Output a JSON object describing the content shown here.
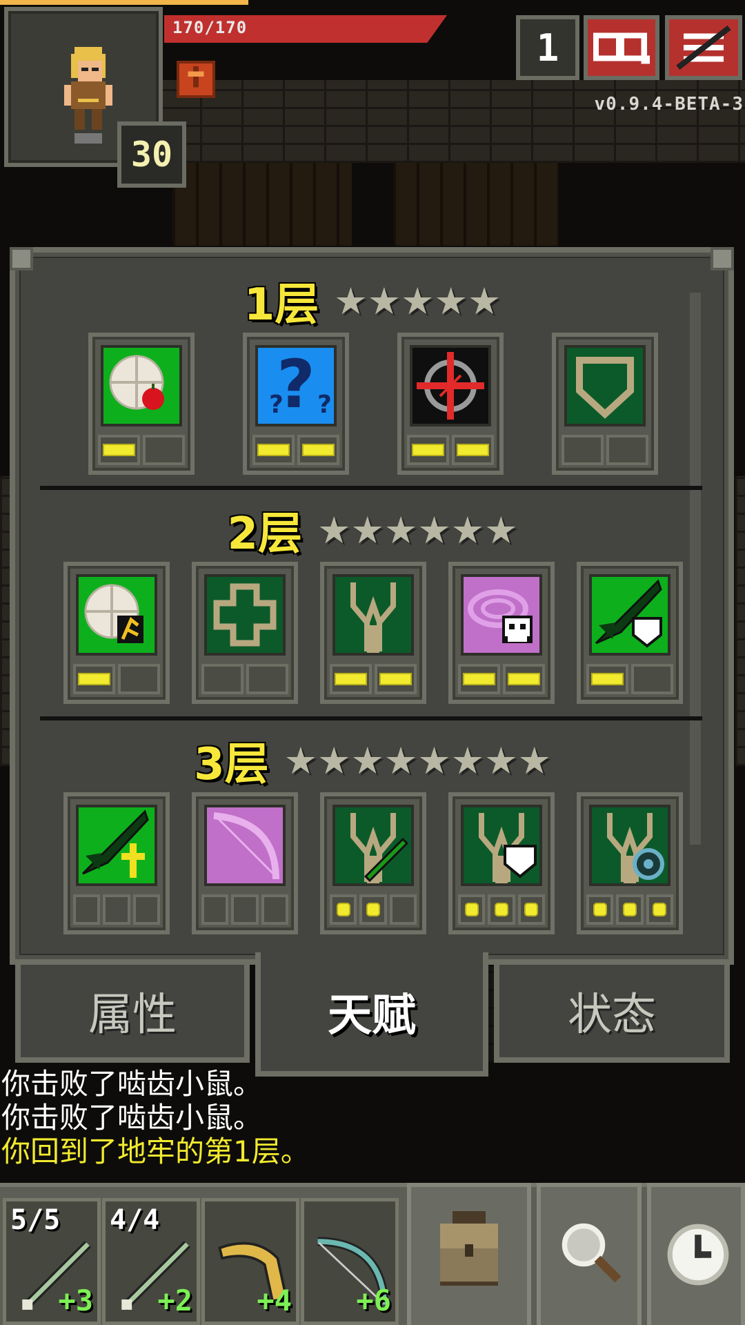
{
  "hud": {
    "hp": "170/170",
    "hp_fraction": 1.0,
    "level": "30",
    "depth": "1",
    "version": "v0.9.4-BETA-3",
    "xp_fraction": 0.33
  },
  "tiers": [
    {
      "title": "1层",
      "stars": "★★★★★",
      "talents": [
        {
          "icon": "plate-apple-icon",
          "points": 1,
          "max": 2
        },
        {
          "icon": "question-mark-icon",
          "points": 2,
          "max": 2
        },
        {
          "icon": "crosshair-icon",
          "points": 2,
          "max": 2
        },
        {
          "icon": "shield-icon",
          "points": 0,
          "max": 2
        }
      ]
    },
    {
      "title": "2层",
      "stars": "★★★★★★",
      "talents": [
        {
          "icon": "plate-rune-icon",
          "points": 1,
          "max": 2
        },
        {
          "icon": "cross-icon",
          "points": 0,
          "max": 2
        },
        {
          "icon": "tree-icon",
          "points": 2,
          "max": 2
        },
        {
          "icon": "swirl-skull-icon",
          "points": 2,
          "max": 2
        },
        {
          "icon": "dart-shield-icon",
          "points": 1,
          "max": 2
        }
      ]
    },
    {
      "title": "3层",
      "stars": "★★★★★★★★",
      "talents": [
        {
          "icon": "dart-ankh-icon",
          "points": 0,
          "max": 3
        },
        {
          "icon": "bow-icon",
          "points": 0,
          "max": 3
        },
        {
          "icon": "tree-dart-icon",
          "points": 2,
          "max": 3
        },
        {
          "icon": "tree-shield-icon",
          "points": 3,
          "max": 3
        },
        {
          "icon": "tree-ring-icon",
          "points": 3,
          "max": 3
        }
      ]
    }
  ],
  "tabs": {
    "stats": "属性",
    "talents": "天赋",
    "buffs": "状态"
  },
  "log": [
    "你击败了啮齿小鼠。",
    "你击败了啮齿小鼠。",
    "你回到了地牢的第1层。"
  ],
  "quickslots": [
    {
      "count": "5/5",
      "bonus": "+3",
      "icon": "dart-icon"
    },
    {
      "count": "4/4",
      "bonus": "+2",
      "icon": "dart-icon"
    },
    {
      "count": "",
      "bonus": "+4",
      "icon": "boomerang-icon"
    },
    {
      "count": "",
      "bonus": "+6",
      "icon": "bow-icon"
    }
  ],
  "colors": {
    "pip_on": "#f2ea2e",
    "tier_title": "#f7e73a",
    "talent_bg": "#0c5a2a",
    "bonus": "#7cf054"
  }
}
